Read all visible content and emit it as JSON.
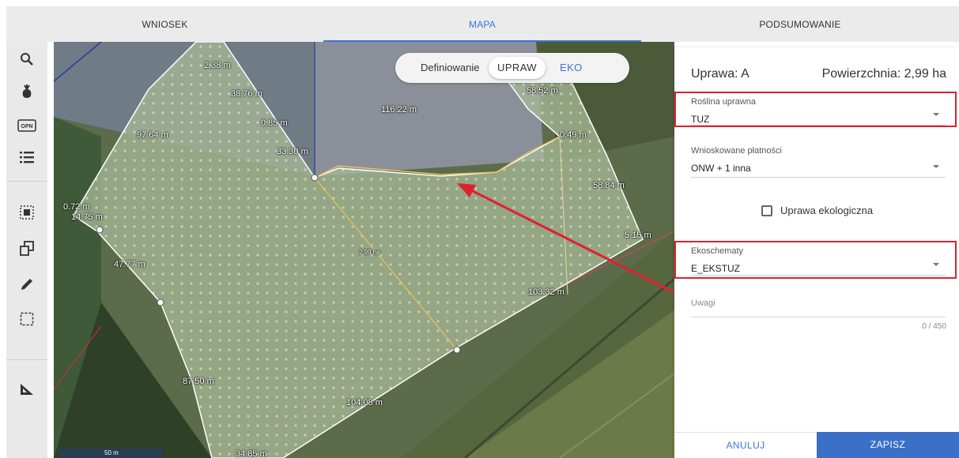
{
  "tabs": [
    {
      "label": "WNIOSEK",
      "active": false
    },
    {
      "label": "MAPA",
      "active": true
    },
    {
      "label": "PODSUMOWANIE",
      "active": false
    }
  ],
  "toolbar": {
    "icons": [
      "search-icon",
      "crop-icon",
      "opn-icon",
      "list-icon",
      "select-area-icon",
      "copy-icon",
      "edit-icon",
      "draw-rectangle-icon",
      "measure-icon"
    ],
    "opn_text": "OPN"
  },
  "map": {
    "mode_toggle": {
      "label": "Definiowanie",
      "selected": "UPRAW",
      "other": "EKO"
    },
    "parcel_area_label": "2.99 ha",
    "measurements": [
      "2.38 m",
      "38.76 m",
      "0.85 m",
      "33.30 m",
      "116.22 m",
      "58.52 m",
      "0.49 m",
      "97.64 m",
      "58.84 m",
      "0.72 m",
      "14.75 m",
      "5.15 m",
      "47.77 m",
      "103.32 m",
      "87.50 m",
      "104.08 m",
      "34.85 m"
    ],
    "scale": "50 m",
    "colors": {
      "parcel_fill": "#9fb48c",
      "parcel_outline": "#ffffff",
      "split_line": "#e8c25a",
      "arrow": "#e0202e"
    }
  },
  "panel": {
    "title": "Uprawa: A",
    "area": "Powierzchnia: 2,99 ha",
    "crop_field": {
      "label": "Roślina uprawna",
      "value": "TUZ"
    },
    "payments_field": {
      "label": "Wnioskowane płatności",
      "value": "ONW + 1 inna"
    },
    "ecological_checkbox": {
      "label": "Uprawa ekologiczna",
      "checked": false
    },
    "ecoschemes_field": {
      "label": "Ekoschematy",
      "value": "E_EKSTUZ"
    },
    "notes": {
      "placeholder": "Uwagi",
      "counter": "0 / 450"
    },
    "cancel_label": "ANULUJ",
    "save_label": "ZAPISZ",
    "accent": "#3a76d4",
    "highlight": "#e0202e"
  }
}
